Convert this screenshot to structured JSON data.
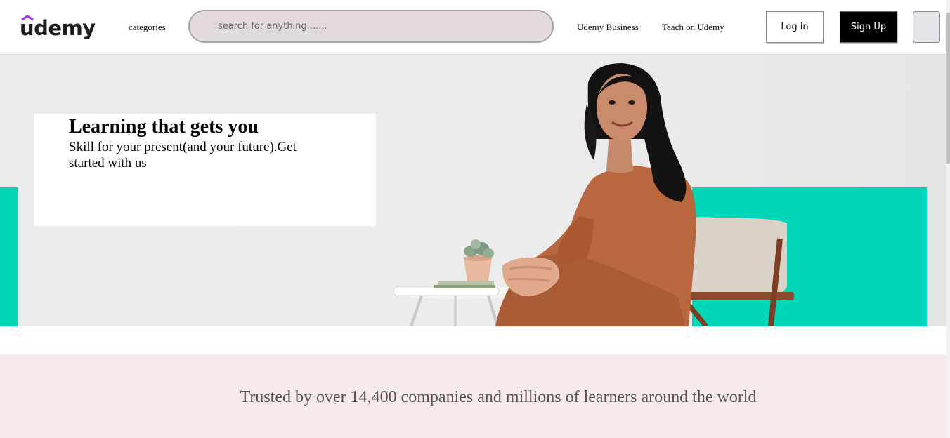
{
  "header": {
    "logo_text": "udemy",
    "categories_label": "categories",
    "search_placeholder": "search for anything.......",
    "nav": {
      "business": "Udemy Business",
      "teach": "Teach on Udemy"
    },
    "login_label": "Log in",
    "signup_label": "Sign Up"
  },
  "hero": {
    "title": "Learning that gets you",
    "subtitle": "Skill for your present(and your future).Get started with us"
  },
  "trusted": {
    "text": "Trusted by over 14,400 companies and millions of learners around the world"
  },
  "colors": {
    "brand_purple": "#a435f0",
    "accent_teal": "#00d6b8",
    "trusted_bg": "#f6ebea",
    "search_bg": "#e3dbdb"
  }
}
